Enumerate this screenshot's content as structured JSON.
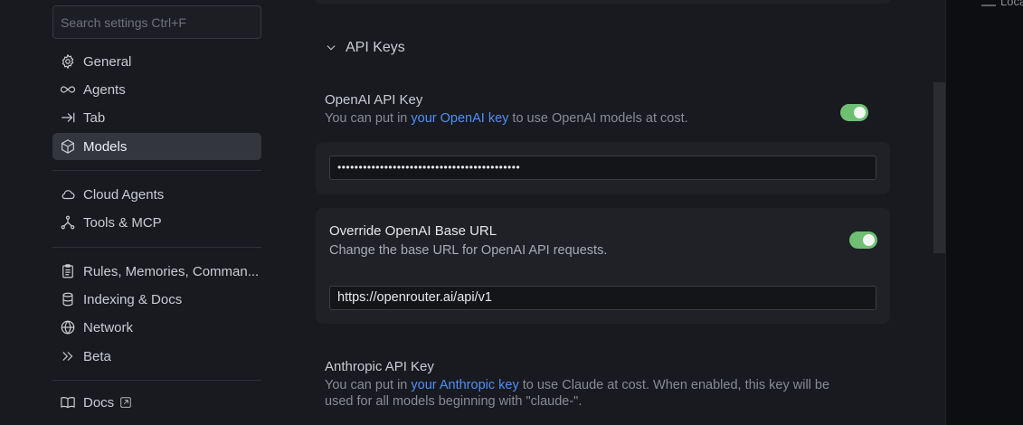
{
  "search": {
    "placeholder": "Search settings Ctrl+F"
  },
  "sidebar": {
    "items": [
      {
        "label": "General",
        "icon": "gear-icon"
      },
      {
        "label": "Agents",
        "icon": "infinity-icon"
      },
      {
        "label": "Tab",
        "icon": "tab-arrow-icon"
      },
      {
        "label": "Models",
        "icon": "cube-icon",
        "active": true
      },
      {
        "label": "Cloud Agents",
        "icon": "cloud-icon"
      },
      {
        "label": "Tools & MCP",
        "icon": "nodes-icon"
      },
      {
        "label": "Rules, Memories, Comman...",
        "icon": "clipboard-icon"
      },
      {
        "label": "Indexing & Docs",
        "icon": "database-icon"
      },
      {
        "label": "Network",
        "icon": "globe-icon"
      },
      {
        "label": "Beta",
        "icon": "double-chevron-icon"
      },
      {
        "label": "Docs",
        "icon": "book-icon"
      }
    ]
  },
  "section": {
    "title": "API Keys"
  },
  "openai": {
    "title": "OpenAI API Key",
    "desc_prefix": "You can put in ",
    "desc_link": "your OpenAI key",
    "desc_suffix": " to use OpenAI models at cost.",
    "enabled": true,
    "key_value": "•••••••••••••••••••••••••••••••••••••••••••"
  },
  "override": {
    "title": "Override OpenAI Base URL",
    "desc": "Change the base URL for OpenAI API requests.",
    "enabled": true,
    "url_value": "https://openrouter.ai/api/v1"
  },
  "anthropic": {
    "title": "Anthropic API Key",
    "desc_prefix": "You can put in ",
    "desc_link": "your Anthropic key",
    "desc_suffix": " to use Claude at cost. When enabled, this key will be",
    "desc_line2": "used for all models beginning with \"claude-\"."
  },
  "right_panel": {
    "fragment": "Loca"
  },
  "colors": {
    "accent_link": "#4f8ff7",
    "toggle_on": "#6fbf73",
    "active_bg": "#33363d"
  }
}
